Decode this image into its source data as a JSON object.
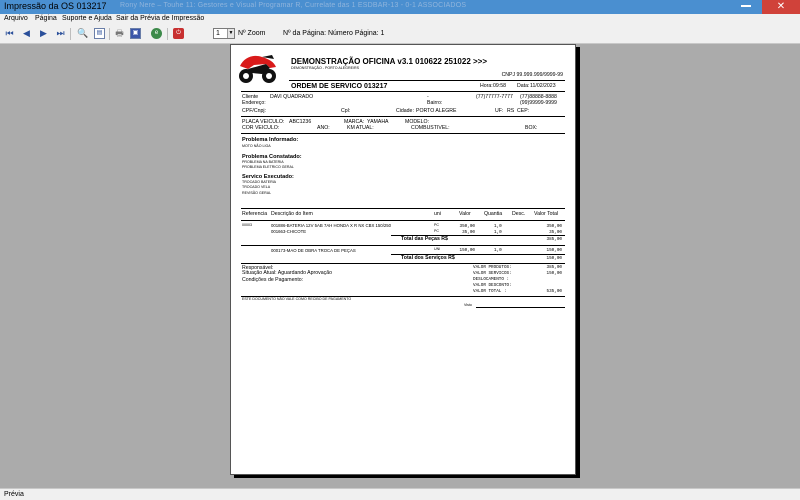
{
  "window": {
    "title": "Impressão da OS 013217",
    "background_text": "Rony Nere – Touhe 11: Gestores e Visual Programar R, Currelate das 1 ESDBAR-13 - 0-1 ASSOCIADOS"
  },
  "menu": [
    "Arquivo",
    "Página",
    "Suporte e Ajuda",
    "Sair da Prévia de Impressão"
  ],
  "toolbar": {
    "icons": [
      "first-page-icon",
      "prev-page-icon",
      "next-page-icon",
      "last-page-icon",
      "zoom-icon",
      "page-layout-icon",
      "print-icon",
      "print-preview-icon",
      "web-icon",
      "pdf-icon"
    ],
    "zoom_value": "1",
    "zoom_label": "Nº Zoom",
    "page_label": "Nº da Página: Número Página: 1"
  },
  "status": {
    "text": "Prévia"
  },
  "colors": {
    "titlebar": "#4a8fd0",
    "close_button": "#d0423a",
    "logo": "#d91a1a"
  },
  "report": {
    "company": {
      "name": "DEMONSTRAÇÃO OFICINA v3.1 010622 251022 >>>",
      "subtitle": "DEMONSTRAÇÃO - PORTO ALEGRE/RS",
      "cnpj": "CNPJ 99.999.999/9999-99"
    },
    "title": "ORDEM DE SERVICO 013217",
    "hora_label": "Hora:",
    "hora": "09:58",
    "data_label": "Data:",
    "data": "11/02/2023",
    "client": {
      "cliente_label": "Cliente",
      "cliente": "DAVI QUADRADO",
      "dash": "-",
      "phone1": "(77)77777-7777",
      "phone2": "(77)88888-8888",
      "endereco_label": "Endereço:",
      "bairro_label": "Bairro:",
      "phone3": "(99)99999-9999",
      "cpf_label": "CPF/Cnpj:",
      "cpl_label": "Cpl:",
      "cidade_label": "Cidade:",
      "cidade": "PORTO ALEGRE",
      "uf_label": "UF:",
      "uf": "RS",
      "cep_label": "CEP:"
    },
    "vehicle": {
      "placa_label": "PLACA VEICULO:",
      "placa": "ABC1236",
      "marca_label": "MARCA:",
      "marca": "YAMAHA",
      "modelo_label": "MODELO:",
      "cor_label": "COR VEICULO:",
      "ano_label": "ANO:",
      "km_label": "KM ATUAL:",
      "combustivel_label": "COMBUSTIVEL:",
      "box_label": "BOX:"
    },
    "problema_informado": {
      "heading": "Problema Informado:",
      "lines": [
        "MOTO NÃO LIGA"
      ]
    },
    "problema_constatado": {
      "heading": "Problema Constatado:",
      "lines": [
        "PROBLEMA NA BATERIA",
        "PROBLEMA ELETRICO GERAL"
      ]
    },
    "servico_executado": {
      "heading": "Servico Executado:",
      "lines": [
        "TROCADO BATERIA",
        "TROCADO VELA",
        "REVISÃO GERAL"
      ]
    },
    "table": {
      "headers": [
        "Referencia",
        "Descrição do Item",
        "uni",
        "Valor",
        "Quantia",
        "Desc.",
        "Valor Total"
      ],
      "ref": "00003",
      "parts": [
        {
          "desc": "001886-BATERIA 12V 5AB 7AH HONDA X R NX CBX 150/250",
          "uni": "PC",
          "valor": "350,00",
          "qtd": "1,0",
          "total": "350,00"
        },
        {
          "desc": "001663-CHICOTE",
          "uni": "PC",
          "valor": "35,00",
          "qtd": "1,0",
          "total": "35,00"
        }
      ],
      "total_pecas_label": "Total das Peças R$",
      "total_pecas": "385,00",
      "services": [
        {
          "desc": "000173-MAO DE OBRA TROCA DE PEÇAS",
          "uni": "UNI",
          "valor": "150,00",
          "qtd": "1,0",
          "total": "150,00"
        }
      ],
      "total_servicos_label": "Total dos Serviços R$",
      "total_servicos": "150,00"
    },
    "footer": {
      "responsavel_label": "Responsável:",
      "situacao": "Situação Atual: Aguardando Aprovação",
      "condicoes": "Condições de Pagamento:",
      "summary": [
        {
          "label": "VALOR PRODUTOS:",
          "value": "385,00"
        },
        {
          "label": "VALOR SERVICOS:",
          "value": "150,00"
        },
        {
          "label": "DESLOCAMENTO  :",
          "value": ""
        },
        {
          "label": "VALOR DESCONTO:",
          "value": ""
        },
        {
          "label": "VALOR TOTAL   :",
          "value": "535,00"
        }
      ],
      "disclaimer": "ESTE DOCUMENTO NÃO VALE COMO RECIBO DE PAGAMENTO",
      "visto_label": "Visto"
    }
  }
}
